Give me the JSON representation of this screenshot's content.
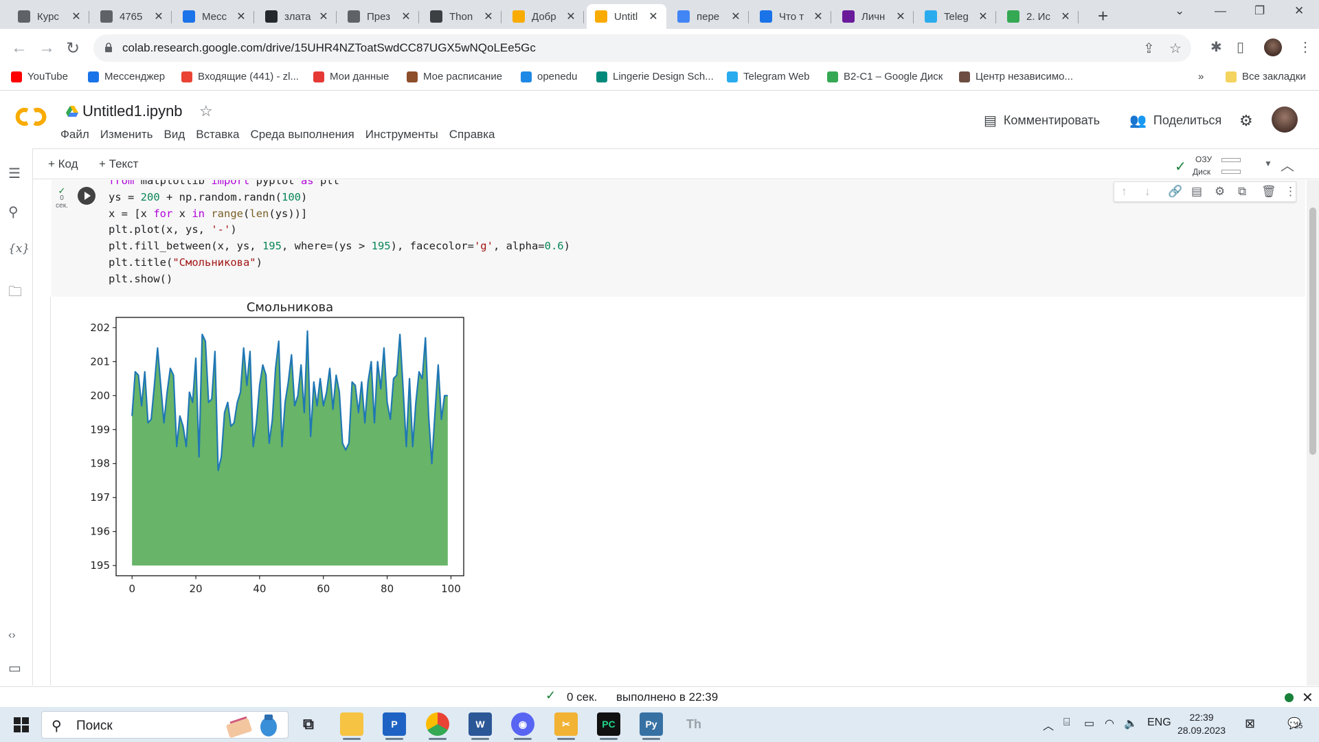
{
  "browser": {
    "tabs": [
      {
        "title": "Курс",
        "color": "#5f6368"
      },
      {
        "title": "4765",
        "color": "#5f6368"
      },
      {
        "title": "Месс",
        "color": "#1a73e8"
      },
      {
        "title": "злата",
        "color": "#24292e"
      },
      {
        "title": "През",
        "color": "#5f6368"
      },
      {
        "title": "Thon",
        "color": "#3c4043"
      },
      {
        "title": "Добр",
        "color": "#f9ab00"
      },
      {
        "title": "Untitl",
        "color": "#f9ab00",
        "active": true
      },
      {
        "title": "пере",
        "color": "#4285f4"
      },
      {
        "title": "Что т",
        "color": "#1a73e8"
      },
      {
        "title": "Личн",
        "color": "#6a1b9a"
      },
      {
        "title": "Teleg",
        "color": "#2aabee"
      },
      {
        "title": "2. Ис",
        "color": "#34a853"
      }
    ],
    "url": "colab.research.google.com/drive/15UHR4NZToatSwdCC87UGX5wNQoLEe5Gc",
    "bookmarks": [
      {
        "label": "YouTube",
        "color": "#ff0000"
      },
      {
        "label": "Мессенджер",
        "color": "#1a73e8"
      },
      {
        "label": "Входящие (441) - zl...",
        "color": "#ea4335"
      },
      {
        "label": "Мои данные",
        "color": "#e53935"
      },
      {
        "label": "Мое расписание",
        "color": "#8d4e2a"
      },
      {
        "label": "openedu",
        "color": "#1e88e5"
      },
      {
        "label": "Lingerie Design Sch...",
        "color": "#00897b"
      },
      {
        "label": "Telegram Web",
        "color": "#2aabee"
      },
      {
        "label": "B2-C1 – Google Диск",
        "color": "#34a853"
      },
      {
        "label": "Центр независимо...",
        "color": "#6d4c41"
      }
    ],
    "more_bookmarks": "»",
    "all_bookmarks": "Все закладки"
  },
  "colab": {
    "notebook_title": "Untitled1.ipynb",
    "menu": [
      "Файл",
      "Изменить",
      "Вид",
      "Вставка",
      "Среда выполнения",
      "Инструменты",
      "Справка"
    ],
    "comment_label": "Комментировать",
    "share_label": "Поделиться",
    "toolbar": {
      "add_code": "+ Код",
      "add_text": "+ Текст"
    },
    "resources": {
      "ram": "ОЗУ",
      "disk": "Диск"
    },
    "cell": {
      "exec_time": "0",
      "exec_unit": "сек.",
      "code_lines": [
        "from matplotlib import pyplot as plt",
        "ys = 200 + np.random.randn(100)",
        "x = [x for x in range(len(ys))]",
        "plt.plot(x, ys, '-')",
        "plt.fill_between(x, ys, 195, where=(ys > 195), facecolor='g', alpha=0.6)",
        "plt.title(\"Смольникова\")",
        "plt.show()"
      ]
    },
    "status": {
      "duration": "0 сек.",
      "completed": "выполнено в 22:39"
    }
  },
  "chart_data": {
    "type": "area",
    "title": "Смольникова",
    "xlabel": "",
    "ylabel": "",
    "xlim": [
      -5,
      104
    ],
    "ylim": [
      194.7,
      202.3
    ],
    "xticks": [
      0,
      20,
      40,
      60,
      80,
      100
    ],
    "yticks": [
      195,
      196,
      197,
      198,
      199,
      200,
      201,
      202
    ],
    "fill_baseline": 195,
    "line_color": "#1f77b4",
    "fill_color": "#68b468",
    "grid": false,
    "x": [
      0,
      1,
      2,
      3,
      4,
      5,
      6,
      7,
      8,
      9,
      10,
      11,
      12,
      13,
      14,
      15,
      16,
      17,
      18,
      19,
      20,
      21,
      22,
      23,
      24,
      25,
      26,
      27,
      28,
      29,
      30,
      31,
      32,
      33,
      34,
      35,
      36,
      37,
      38,
      39,
      40,
      41,
      42,
      43,
      44,
      45,
      46,
      47,
      48,
      49,
      50,
      51,
      52,
      53,
      54,
      55,
      56,
      57,
      58,
      59,
      60,
      61,
      62,
      63,
      64,
      65,
      66,
      67,
      68,
      69,
      70,
      71,
      72,
      73,
      74,
      75,
      76,
      77,
      78,
      79,
      80,
      81,
      82,
      83,
      84,
      85,
      86,
      87,
      88,
      89,
      90,
      91,
      92,
      93,
      94,
      95,
      96,
      97,
      98,
      99
    ],
    "y": [
      199.4,
      200.7,
      200.6,
      199.7,
      200.7,
      199.2,
      199.3,
      200.3,
      201.4,
      200.3,
      199.2,
      200.1,
      200.8,
      200.6,
      198.5,
      199.4,
      199.1,
      198.5,
      200.1,
      199.8,
      201.1,
      198.2,
      201.8,
      201.6,
      199.8,
      199.9,
      201.3,
      197.8,
      198.2,
      199.5,
      199.8,
      199.1,
      199.2,
      199.8,
      200.1,
      201.4,
      200.3,
      201.3,
      198.5,
      199.2,
      200.3,
      200.9,
      200.6,
      198.6,
      199.3,
      200.8,
      201.6,
      198.5,
      199.8,
      200.4,
      201.2,
      199.7,
      200.0,
      200.9,
      199.5,
      201.9,
      198.8,
      200.4,
      199.7,
      200.5,
      199.7,
      200.1,
      200.8,
      199.6,
      200.6,
      200.1,
      198.6,
      198.4,
      198.6,
      200.4,
      200.3,
      199.5,
      200.4,
      199.2,
      200.4,
      201.0,
      199.2,
      201.0,
      200.2,
      201.4,
      199.8,
      199.3,
      200.5,
      200.6,
      201.8,
      200.2,
      198.5,
      200.5,
      198.5,
      199.8,
      200.7,
      200.5,
      201.7,
      199.4,
      198.0,
      199.5,
      200.9,
      199.3,
      200.0,
      200.0
    ]
  },
  "taskbar": {
    "search_placeholder": "Поиск",
    "language": "ENG",
    "time": "22:39",
    "date": "28.09.2023",
    "notifications": "25"
  }
}
